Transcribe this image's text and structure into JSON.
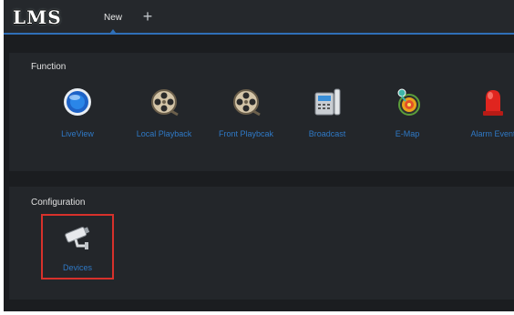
{
  "app": {
    "logo": "LMS"
  },
  "tabs": [
    {
      "label": "New"
    }
  ],
  "function_panel": {
    "title": "Function",
    "items": [
      {
        "label": "LiveView",
        "icon": "liveview-icon"
      },
      {
        "label": "Local Playback",
        "icon": "film-reel-icon"
      },
      {
        "label": "Front Playbcak",
        "icon": "film-reel-icon"
      },
      {
        "label": "Broadcast",
        "icon": "broadcast-phone-icon"
      },
      {
        "label": "E-Map",
        "icon": "map-target-icon"
      },
      {
        "label": "Alarm Event",
        "icon": "alarm-light-icon"
      }
    ]
  },
  "configuration_panel": {
    "title": "Configuration",
    "items": [
      {
        "label": "Devices",
        "icon": "camera-icon"
      }
    ]
  },
  "colors": {
    "accent": "#2f6fb8",
    "label": "#2f79c6",
    "highlight": "#d7312b",
    "background": "#1b1d20",
    "panel": "#23262a"
  }
}
